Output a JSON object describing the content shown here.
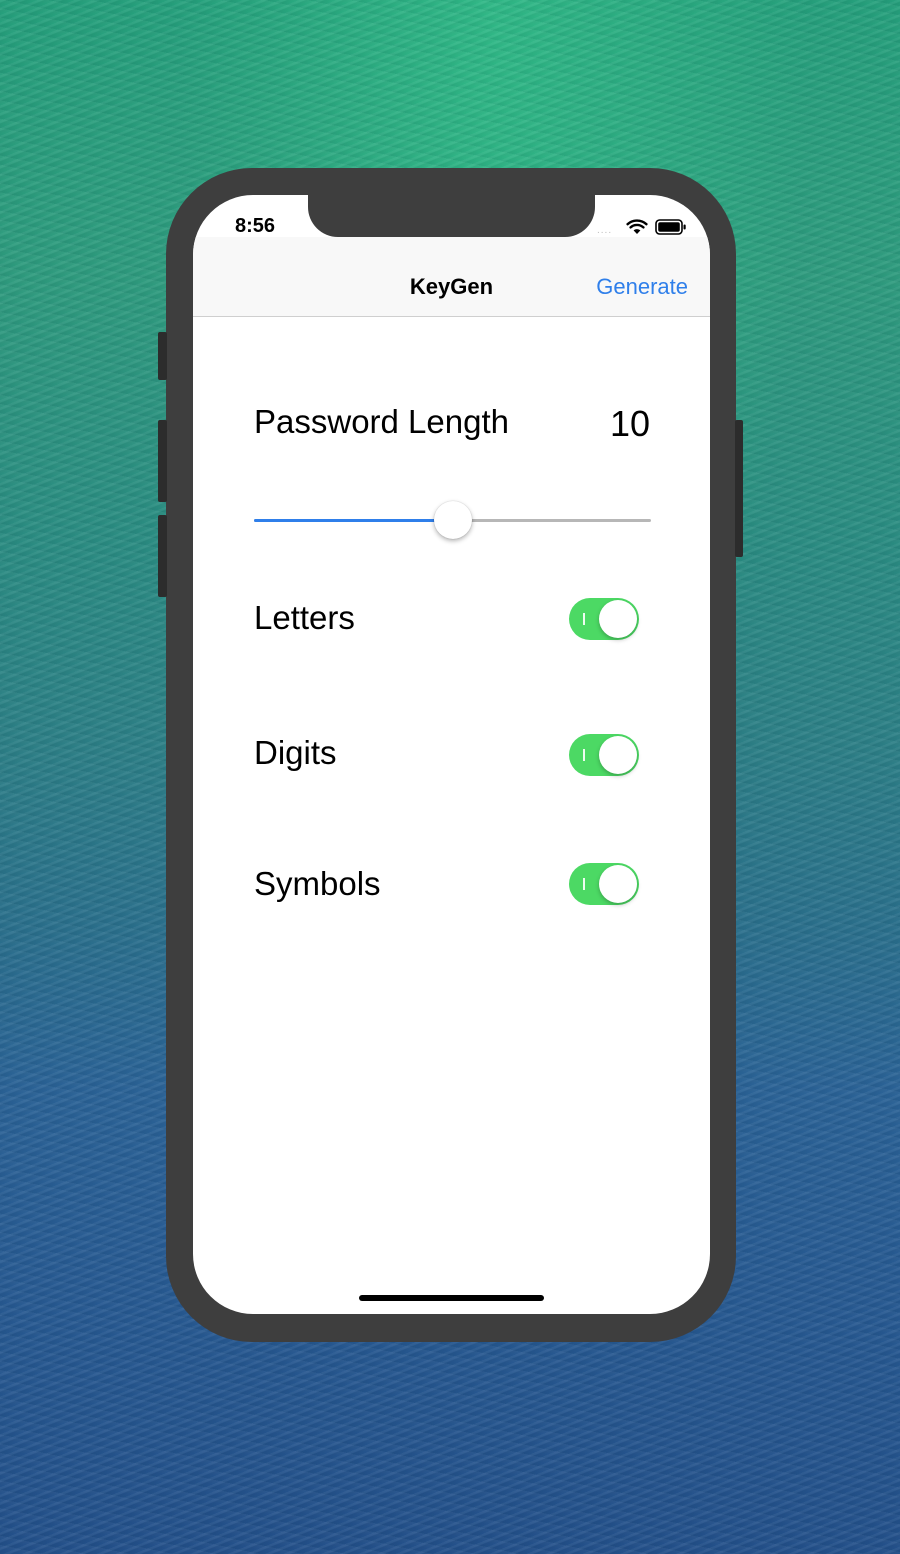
{
  "status_bar": {
    "time": "8:56",
    "signal": "....",
    "wifi_icon": "wifi-icon",
    "battery_icon": "battery-icon"
  },
  "navbar": {
    "title": "KeyGen",
    "generate_label": "Generate"
  },
  "settings": {
    "password_length_label": "Password Length",
    "password_length_value": "10",
    "slider_fraction": 0.5,
    "letters_label": "Letters",
    "letters_on": true,
    "digits_label": "Digits",
    "digits_on": true,
    "symbols_label": "Symbols",
    "symbols_on": true
  },
  "colors": {
    "accent": "#2f7fea",
    "toggle_on": "#4cd964",
    "device": "#3e3e3e"
  }
}
